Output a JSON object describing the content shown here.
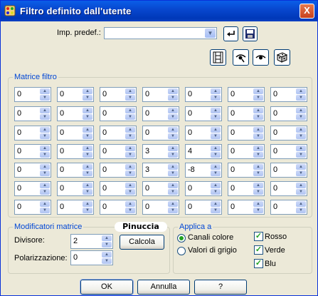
{
  "window": {
    "title": "Filtro definito dall'utente",
    "close_label": "X"
  },
  "preset": {
    "label": "Imp. predef.:",
    "value": ""
  },
  "matrix": {
    "legend": "Matrice filtro",
    "rows": [
      [
        "0",
        "0",
        "0",
        "0",
        "0",
        "0",
        "0"
      ],
      [
        "0",
        "0",
        "0",
        "0",
        "0",
        "0",
        "0"
      ],
      [
        "0",
        "0",
        "0",
        "0",
        "0",
        "0",
        "0"
      ],
      [
        "0",
        "0",
        "0",
        "3",
        "4",
        "0",
        "0"
      ],
      [
        "0",
        "0",
        "0",
        "3",
        "-8",
        "0",
        "0"
      ],
      [
        "0",
        "0",
        "0",
        "0",
        "0",
        "0",
        "0"
      ],
      [
        "0",
        "0",
        "0",
        "0",
        "0",
        "0",
        "0"
      ]
    ]
  },
  "modifiers": {
    "legend": "Modificatori matrice",
    "divisor_label": "Divisore:",
    "divisor_value": "2",
    "bias_label": "Polarizzazione:",
    "bias_value": "0",
    "calc_label": "Calcola"
  },
  "watermark": "Pinuccia",
  "apply": {
    "legend": "Applica a",
    "radio_color": "Canali colore",
    "radio_gray": "Valori di grigio",
    "selected": "color",
    "check_red": "Rosso",
    "check_green": "Verde",
    "check_blue": "Blu"
  },
  "buttons": {
    "ok": "OK",
    "cancel": "Annulla",
    "help": "?"
  },
  "colors": {
    "titlebar": "#0a5ee8",
    "group_legend": "#0046d5",
    "check_mark": "#21a121"
  }
}
